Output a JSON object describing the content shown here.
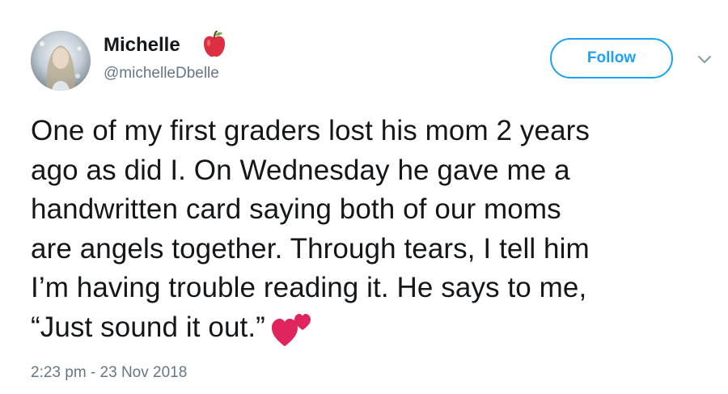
{
  "author": {
    "display_name": "Michelle",
    "handle": "@michelleDbelle",
    "avatar_icon": "avatar",
    "name_emoji_icon": "red-apple-icon"
  },
  "actions": {
    "follow_label": "Follow",
    "menu_icon": "chevron-down-icon"
  },
  "tweet": {
    "lines": [
      "One of my first graders lost his mom 2 years",
      "ago as did I. On Wednesday he gave me a",
      "handwritten card saying both of our moms",
      "are angels together. Through tears, I tell him",
      "I’m having trouble reading it. He says to me,",
      "“Just sound it out.”"
    ],
    "trailing_emoji_icon": "two-hearts-icon"
  },
  "meta": {
    "timestamp": "2:23 pm - 23 Nov 2018"
  },
  "colors": {
    "accent": "#1da1f2",
    "text": "#14171a",
    "secondary_text": "#657786",
    "heart": "#e0245e",
    "apple": "#dd2e44"
  }
}
